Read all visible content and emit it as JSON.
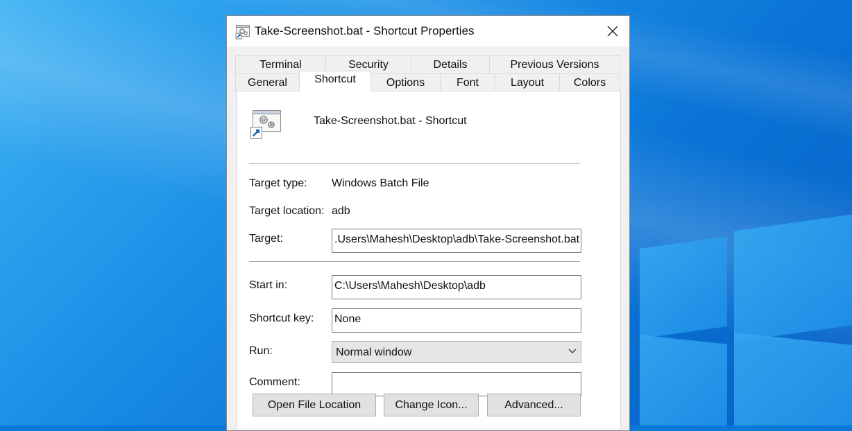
{
  "window": {
    "title": "Take-Screenshot.bat - Shortcut Properties"
  },
  "tabs": {
    "row1": [
      "Terminal",
      "Security",
      "Details",
      "Previous Versions"
    ],
    "row2": [
      "General",
      "Shortcut",
      "Options",
      "Font",
      "Layout",
      "Colors"
    ],
    "active": "Shortcut"
  },
  "shortcut": {
    "name": "Take-Screenshot.bat - Shortcut",
    "target_type_label": "Target type:",
    "target_type_value": "Windows Batch File",
    "target_location_label": "Target location:",
    "target_location_value": "adb",
    "target_label": "Target:",
    "target_value": ".Users\\Mahesh\\Desktop\\adb\\Take-Screenshot.bat",
    "start_in_label": "Start in:",
    "start_in_value": "C:\\Users\\Mahesh\\Desktop\\adb",
    "shortcut_key_label": "Shortcut key:",
    "shortcut_key_value": "None",
    "run_label": "Run:",
    "run_value": "Normal window",
    "comment_label": "Comment:",
    "comment_value": ""
  },
  "buttons": {
    "open_file_location": "Open File Location",
    "change_icon": "Change Icon...",
    "advanced": "Advanced..."
  },
  "icons": [
    "batch-file-icon",
    "close-icon",
    "shortcut-file-icon",
    "chevron-down-icon"
  ],
  "colors": {
    "desktop": "#0a78d7",
    "window_bg": "#f0f0f0",
    "button_bg": "#e1e1e1"
  }
}
